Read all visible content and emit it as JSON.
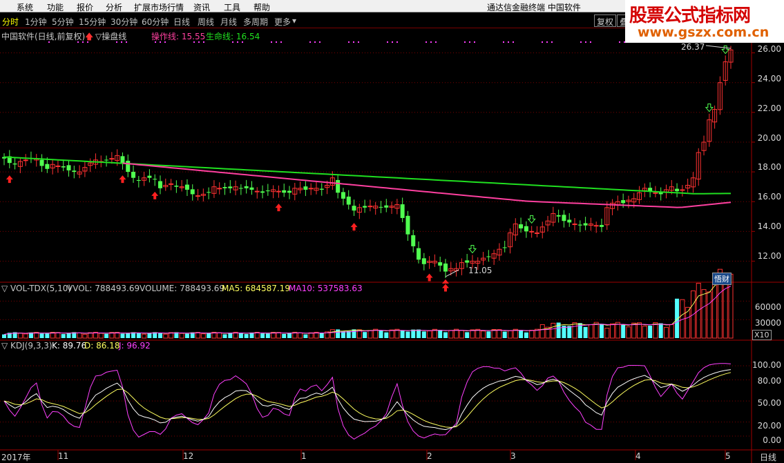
{
  "menubar": {
    "items": [
      "系统",
      "功能",
      "报价",
      "分析",
      "扩展市场行情",
      "资讯",
      "工具",
      "帮助"
    ],
    "brand": "通达信金融终端 中国软件"
  },
  "watermark": {
    "title": "股票公式指标网",
    "url": "www.gszx.com.cn"
  },
  "tabs": [
    "分时",
    "1分钟",
    "5分钟",
    "15分钟",
    "30分钟",
    "60分钟",
    "日线",
    "周线",
    "月线",
    "多周期",
    "更多"
  ],
  "active_tab": "分时",
  "toolbar": {
    "fuquan": "复权",
    "overlay": "叠"
  },
  "header": {
    "stock": "中国软件(日线,前复权)",
    "indicator": "▽操盘线",
    "caozuo": "操作线: 15.55",
    "shengming": "生命线: 16.54"
  },
  "price_panel": {
    "y_ticks": [
      "26.00",
      "24.00",
      "22.00",
      "20.00",
      "18.00",
      "16.00",
      "14.00",
      "12.00"
    ],
    "high_label": "26.37",
    "low_label": "11.05",
    "badge": "悟财"
  },
  "vol_panel": {
    "title": "▽ VOL-TDX(5,10)",
    "vvol": "VVOL: 788493.69",
    "volume": "VOLUME: 788493.69",
    "ma5": "MA5: 684587.19",
    "ma10": "MA10: 537583.63",
    "y_ticks": [
      "60000",
      "30000"
    ],
    "unit": "X10"
  },
  "kdj_panel": {
    "title": "▽ KDJ(9,3,3)",
    "k": "K: 89.76",
    "d": "D: 86.18",
    "j": "J: 96.92",
    "y_ticks": [
      "100.00",
      "80.00",
      "50.00",
      "20.00",
      "0.00"
    ]
  },
  "x_axis": {
    "labels": [
      "2017年",
      "11",
      "12",
      "1",
      "2",
      "3",
      "4",
      "5"
    ],
    "period": "日线"
  },
  "colors": {
    "up": "#ff3232",
    "down": "#54ffff",
    "green_candle": "#50ff50",
    "ma_green": "#20e020",
    "ma_pink": "#ff40a0",
    "k_line": "#ffffff",
    "d_line": "#ffff60",
    "j_line": "#ff40ff",
    "grid": "#800000"
  },
  "chart_data": {
    "type": "candlestick",
    "ylim": [
      11,
      26.4
    ],
    "closes": [
      18.9,
      18.6,
      18.5,
      18.7,
      18.8,
      18.9,
      18.9,
      18.4,
      18.2,
      18.5,
      18.4,
      18.3,
      18.1,
      18.0,
      18.0,
      18.3,
      18.6,
      18.8,
      18.7,
      18.8,
      18.9,
      19.1,
      18.6,
      18.0,
      17.6,
      17.4,
      17.6,
      17.6,
      17.5,
      16.9,
      17.1,
      17.2,
      17.0,
      17.0,
      16.8,
      16.5,
      16.4,
      16.5,
      16.6,
      17.0,
      16.9,
      16.9,
      16.9,
      17.0,
      16.9,
      16.9,
      16.8,
      16.7,
      16.6,
      16.7,
      16.8,
      16.7,
      16.6,
      16.6,
      16.9,
      16.9,
      16.8,
      16.9,
      16.9,
      16.8,
      17.1,
      17.6,
      16.6,
      16.2,
      15.8,
      15.4,
      15.6,
      15.6,
      15.7,
      15.7,
      15.6,
      15.6,
      15.7,
      15.8,
      14.9,
      13.8,
      13.0,
      12.1,
      11.8,
      12.0,
      12.0,
      11.7,
      11.3,
      11.5,
      11.5,
      11.9,
      11.9,
      12.0,
      12.0,
      12.2,
      12.3,
      12.5,
      12.8,
      12.9,
      13.9,
      14.5,
      14.2,
      14.0,
      14.0,
      13.9,
      14.3,
      14.7,
      15.2,
      15.0,
      14.7,
      14.6,
      14.5,
      14.4,
      14.4,
      14.5,
      14.4,
      14.3,
      15.6,
      15.9,
      16.0,
      15.9,
      16.1,
      16.2,
      16.6,
      16.9,
      16.7,
      16.6,
      16.5,
      16.8,
      17.0,
      16.7,
      16.8,
      17.1,
      17.6,
      19.3,
      20.0,
      21.5,
      22.2,
      24.0,
      25.4,
      26.2
    ],
    "ma_caozuo_end": 15.55,
    "ma_shengming_end": 16.54,
    "buy_signal_index": [
      1,
      22,
      28,
      51,
      65,
      79,
      82
    ]
  }
}
